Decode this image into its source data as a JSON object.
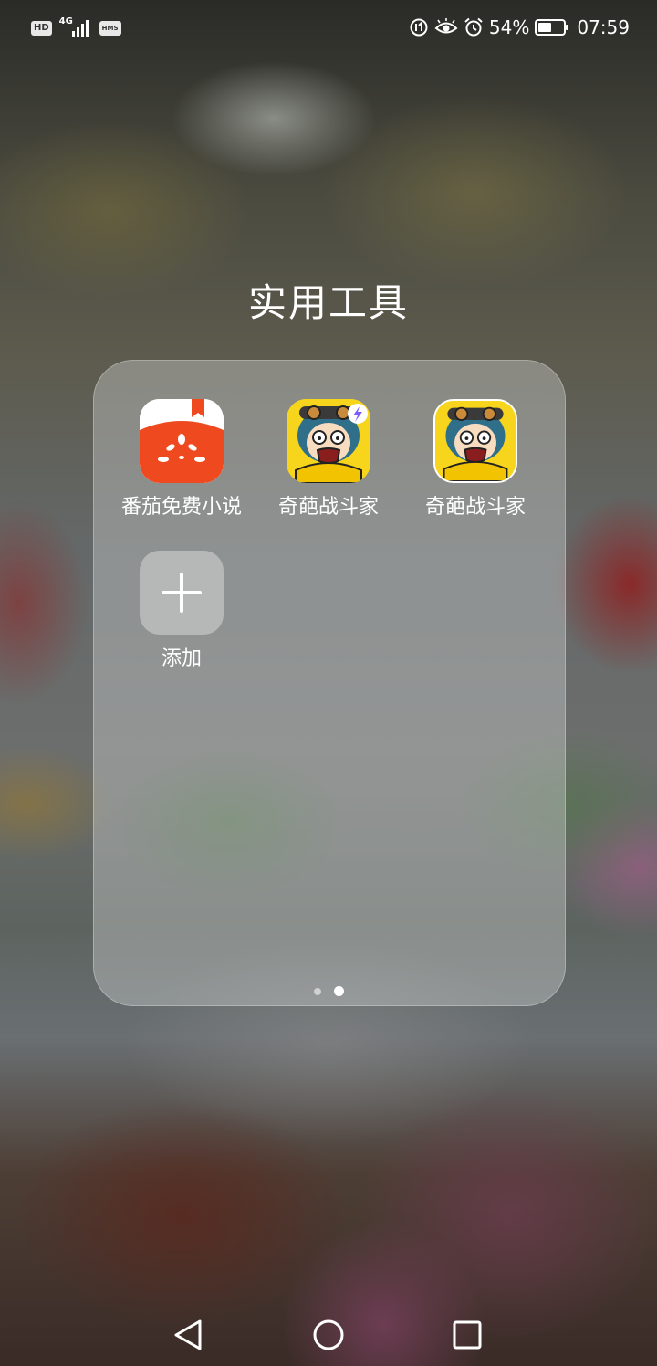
{
  "status_bar": {
    "hd_badge": "HD",
    "network_type": "4G",
    "hms_badge": "HMS",
    "battery_percent": "54%",
    "time": "07:59",
    "battery_level": 0.54,
    "icons": [
      "data-saver-icon",
      "eye-comfort-icon",
      "alarm-icon",
      "battery-icon"
    ]
  },
  "folder": {
    "title": "实用工具",
    "apps": [
      {
        "label": "番茄免费小说",
        "icon": "fanqie-novel-icon"
      },
      {
        "label": "奇葩战斗家",
        "icon": "qipa-fighter-icon-accelerated"
      },
      {
        "label": "奇葩战斗家",
        "icon": "qipa-fighter-icon"
      },
      {
        "label": "添加",
        "icon": "plus-icon"
      }
    ],
    "page_count": 2,
    "current_page": 2
  },
  "nav_bar": {
    "buttons": [
      "back-icon",
      "home-icon",
      "recents-icon"
    ]
  },
  "colors": {
    "fanqie_red": "#ef4a1f",
    "fanqie_white": "#ffffff",
    "game_yellow": "#f6d51c"
  }
}
